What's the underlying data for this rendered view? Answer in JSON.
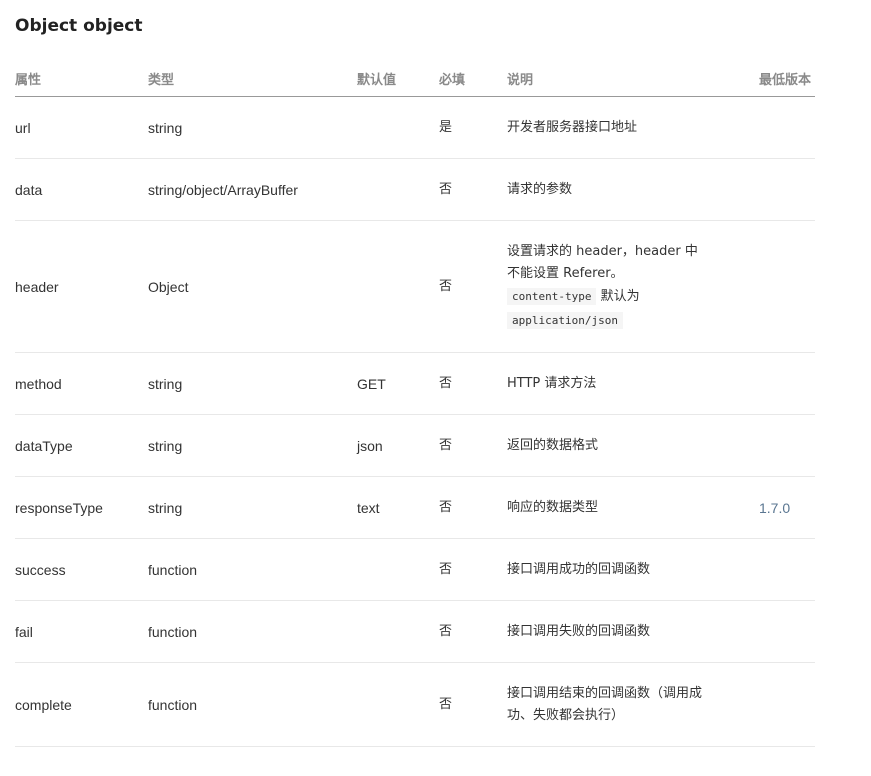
{
  "title": "Object object",
  "columns": [
    "属性",
    "类型",
    "默认值",
    "必填",
    "说明",
    "最低版本"
  ],
  "rows": [
    {
      "name": "url",
      "type": "string",
      "default": "",
      "required": "是",
      "desc": "开发者服务器接口地址",
      "version": ""
    },
    {
      "name": "data",
      "type": "string/object/ArrayBuffer",
      "default": "",
      "required": "否",
      "desc": "请求的参数",
      "version": ""
    },
    {
      "name": "header",
      "type": "Object",
      "default": "",
      "required": "否",
      "desc_line1": "设置请求的 header，header 中",
      "desc_line2": "不能设置 Referer。",
      "desc_code1": "content-type",
      "desc_mid": " 默认为",
      "desc_code2": "application/json",
      "version": ""
    },
    {
      "name": "method",
      "type": "string",
      "default": "GET",
      "required": "否",
      "desc": "HTTP 请求方法",
      "version": ""
    },
    {
      "name": "dataType",
      "type": "string",
      "default": "json",
      "required": "否",
      "desc": "返回的数据格式",
      "version": ""
    },
    {
      "name": "responseType",
      "type": "string",
      "default": "text",
      "required": "否",
      "desc": "响应的数据类型",
      "version": "1.7.0"
    },
    {
      "name": "success",
      "type": "function",
      "default": "",
      "required": "否",
      "desc": "接口调用成功的回调函数",
      "version": ""
    },
    {
      "name": "fail",
      "type": "function",
      "default": "",
      "required": "否",
      "desc": "接口调用失败的回调函数",
      "version": ""
    },
    {
      "name": "complete",
      "type": "function",
      "default": "",
      "required": "否",
      "desc_line1": "接口调用结束的回调函数（调用成",
      "desc_line2": "功、失败都会执行）",
      "version": ""
    }
  ]
}
